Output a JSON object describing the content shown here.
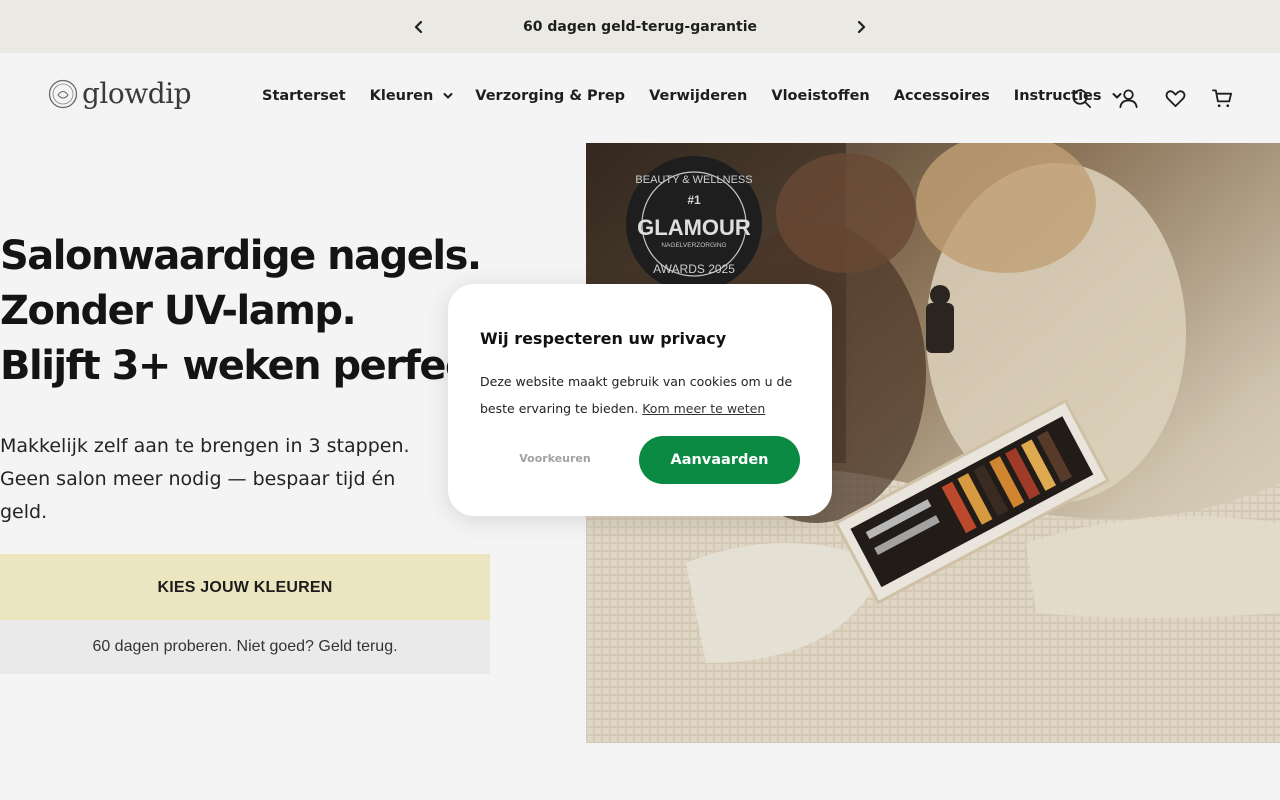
{
  "announcement": {
    "text": "60 dagen geld-terug-garantie",
    "prev_icon": "chevron-left-icon",
    "next_icon": "chevron-right-icon"
  },
  "header": {
    "logo_text": "glowdip",
    "nav": [
      {
        "label": "Starterset",
        "dropdown": false
      },
      {
        "label": "Kleuren",
        "dropdown": true
      },
      {
        "label": "Verzorging & Prep",
        "dropdown": false
      },
      {
        "label": "Verwijderen",
        "dropdown": false
      },
      {
        "label": "Vloeistoffen",
        "dropdown": false
      },
      {
        "label": "Accessoires",
        "dropdown": false
      },
      {
        "label": "Instructies",
        "dropdown": true
      }
    ],
    "icons": [
      "search-icon",
      "account-icon",
      "heart-icon",
      "cart-icon"
    ]
  },
  "hero": {
    "headline": [
      "Salonwaardige nagels.",
      "Zonder UV-lamp.",
      "Blijft 3+ weken perfect."
    ],
    "subtext": "Makkelijk zelf aan te brengen in 3 stappen. Geen salon meer nodig — bespaar tijd én geld.",
    "cta_label": "KIES JOUW KLEUREN",
    "guarantee": "60 dagen proberen. Niet goed? Geld terug.",
    "badge": {
      "top": "BEAUTY & WELLNESS",
      "rank": "#1",
      "brand": "GLAMOUR",
      "category": "NAGELVERZORGING",
      "bottom": "AWARDS 2025"
    }
  },
  "cookie_modal": {
    "title": "Wij respecteren uw privacy",
    "body": "Deze website maakt gebruik van cookies om u de beste ervaring te bieden.",
    "link": "Kom meer te weten",
    "preferences_label": "Voorkeuren",
    "accept_label": "Aanvaarden"
  },
  "colors": {
    "accept_green": "#0a8a43",
    "cta_bg": "#f6f1c8",
    "announce_bg": "#f6f4ef"
  }
}
